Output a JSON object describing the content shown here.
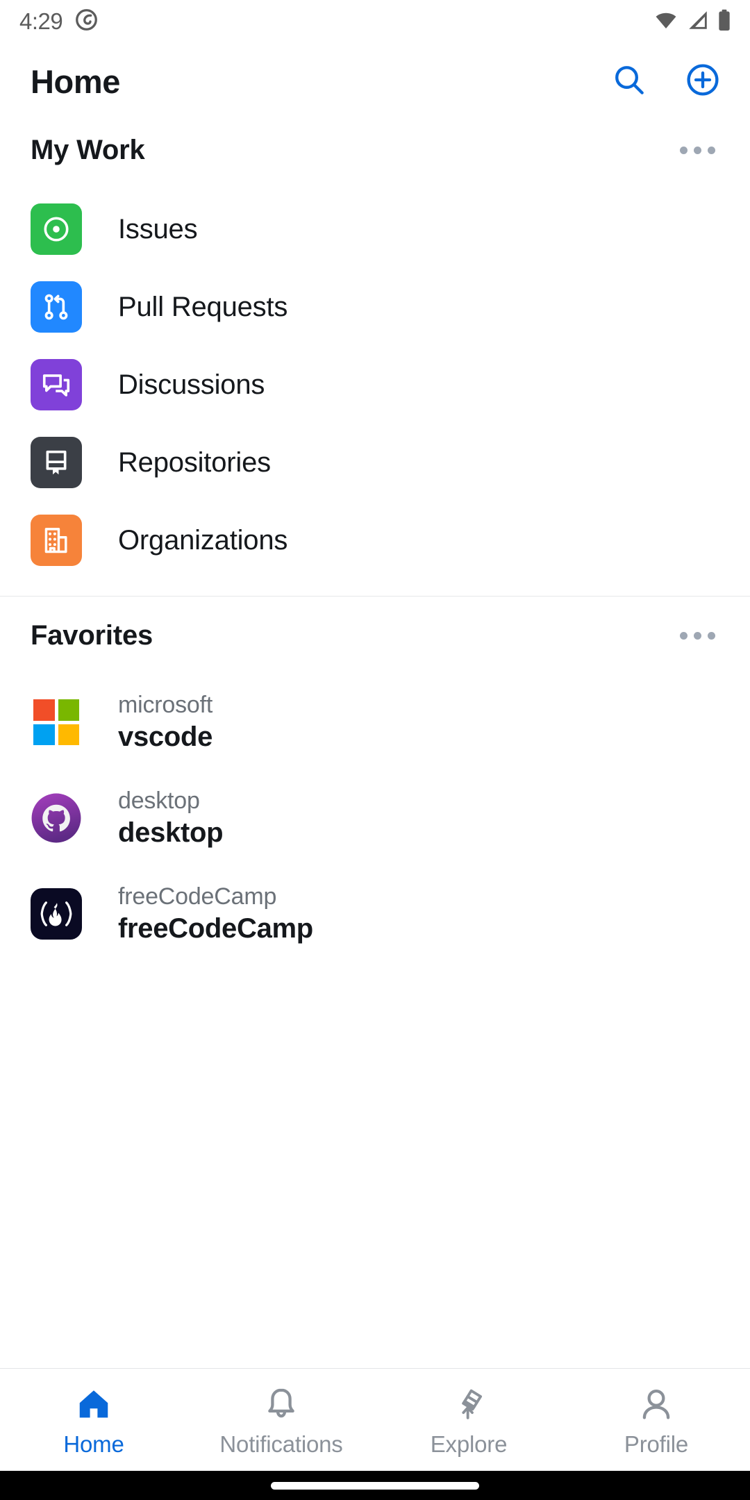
{
  "status_bar": {
    "time": "4:29",
    "icons": [
      "notification-badge-icon",
      "wifi-icon",
      "cellular-signal-icon",
      "battery-icon"
    ]
  },
  "header": {
    "title": "Home",
    "search_label": "Search",
    "create_label": "Create new"
  },
  "my_work": {
    "title": "My Work",
    "menu_label": "More options",
    "items": [
      {
        "label": "Issues",
        "icon": "issue-opened-icon",
        "color": "#2DBE4E"
      },
      {
        "label": "Pull Requests",
        "icon": "git-pull-request-icon",
        "color": "#2188FF"
      },
      {
        "label": "Discussions",
        "icon": "comment-discussion-icon",
        "color": "#8041D9"
      },
      {
        "label": "Repositories",
        "icon": "repo-icon",
        "color": "#3B3F46"
      },
      {
        "label": "Organizations",
        "icon": "organization-icon",
        "color": "#F6833A"
      }
    ]
  },
  "favorites": {
    "title": "Favorites",
    "menu_label": "More options",
    "items": [
      {
        "owner": "microsoft",
        "name": "vscode",
        "avatar": "microsoft-logo-icon"
      },
      {
        "owner": "desktop",
        "name": "desktop",
        "avatar": "github-octocat-avatar-icon"
      },
      {
        "owner": "freeCodeCamp",
        "name": "freeCodeCamp",
        "avatar": "freecodecamp-logo-icon"
      }
    ]
  },
  "bottom_nav": {
    "items": [
      {
        "label": "Home",
        "icon": "home-icon",
        "active": true
      },
      {
        "label": "Notifications",
        "icon": "bell-icon",
        "active": false
      },
      {
        "label": "Explore",
        "icon": "telescope-icon",
        "active": false
      },
      {
        "label": "Profile",
        "icon": "person-icon",
        "active": false
      }
    ]
  },
  "colors": {
    "accent": "#0969da",
    "text_primary": "#15181c",
    "text_muted": "#6b7178",
    "nav_inactive": "#8b9199"
  }
}
